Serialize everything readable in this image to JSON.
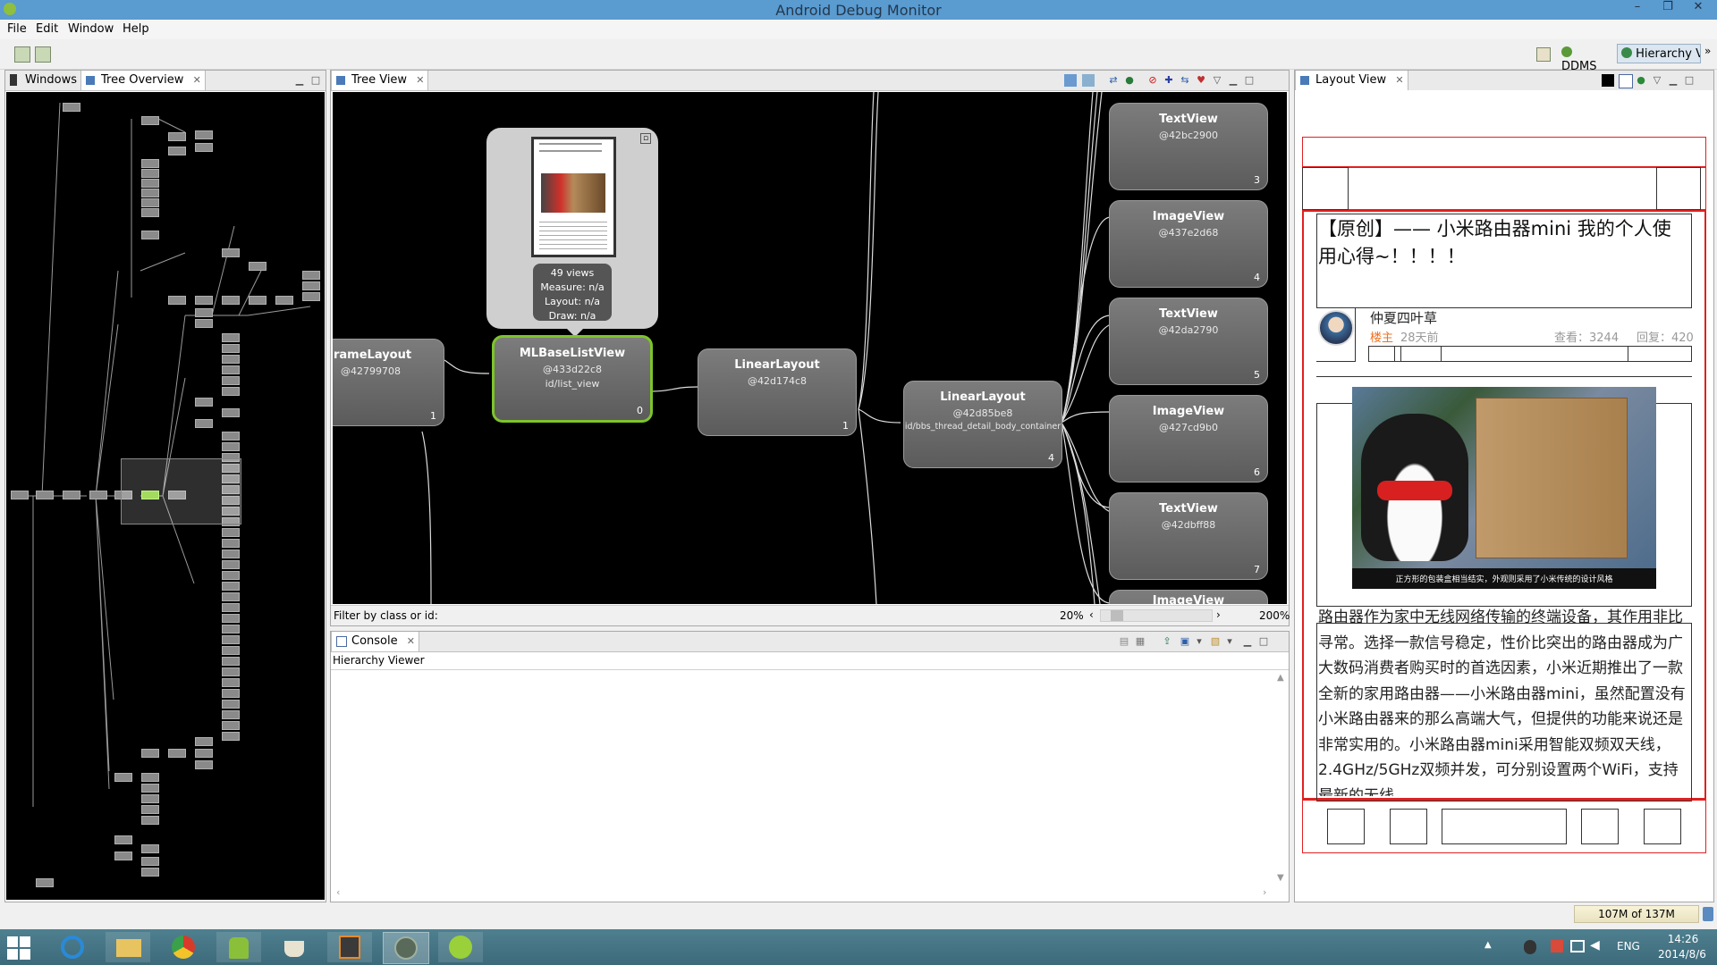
{
  "window": {
    "title": "Android Debug Monitor",
    "controls": [
      "–",
      "❐",
      "✕"
    ]
  },
  "menu": [
    "File",
    "Edit",
    "Window",
    "Help"
  ],
  "perspectives": {
    "ddms": "DDMS",
    "hierarchy": "Hierarchy Vi"
  },
  "left_panel": {
    "tabs": [
      "Windows",
      "Tree Overview"
    ]
  },
  "tree_view": {
    "tab": "Tree View",
    "preview": {
      "views": "49 views",
      "measure": "Measure: n/a",
      "layout": "Layout: n/a",
      "draw": "Draw: n/a"
    },
    "nodes": [
      {
        "cls": "rameLayout",
        "hash": "@42799708",
        "id": "",
        "index": "1"
      },
      {
        "cls": "MLBaseListView",
        "hash": "@433d22c8",
        "id": "id/list_view",
        "index": "0"
      },
      {
        "cls": "LinearLayout",
        "hash": "@42d174c8",
        "id": "",
        "index": "1"
      },
      {
        "cls": "LinearLayout",
        "hash": "@42d85be8",
        "id": "id/bbs_thread_detail_body_container",
        "index": "4"
      },
      {
        "cls": "TextView",
        "hash": "@42bc2900",
        "id": "",
        "index": "3"
      },
      {
        "cls": "ImageView",
        "hash": "@437e2d68",
        "id": "",
        "index": "4"
      },
      {
        "cls": "TextView",
        "hash": "@42da2790",
        "id": "",
        "index": "5"
      },
      {
        "cls": "ImageView",
        "hash": "@427cd9b0",
        "id": "",
        "index": "6"
      },
      {
        "cls": "TextView",
        "hash": "@42dbff88",
        "id": "",
        "index": "7"
      },
      {
        "cls": "ImageView",
        "hash": "",
        "id": "",
        "index": ""
      }
    ],
    "filter_label": "Filter by class or id:",
    "zoom_min": "20%",
    "zoom_max": "200%",
    "zoom_level": 0.1
  },
  "console": {
    "tab": "Console",
    "header": "Hierarchy Viewer"
  },
  "layout_view": {
    "tab": "Layout View",
    "post_title": "【原创】—— 小米路由器mini 我的个人使用心得~！！！！",
    "author": "仲夏四叶草",
    "badge": "楼主",
    "time": "28天前",
    "views": "查看：3244",
    "replies": "回复：420",
    "image_caption": "正方形的包装盒相当结实，外观则采用了小米传统的设计风格",
    "body": "路由器作为家中无线网络传输的终端设备，其作用非比寻常。选择一款信号稳定，性价比突出的路由器成为广大数码消费者购买时的首选因素，小米近期推出了一款全新的家用路由器——小米路由器mini，虽然配置没有小米路由器来的那么高端大气，但提供的功能来说还是非常实用的。小米路由器mini采用智能双频双天线，2.4GHz/5GHz双频并发，可分别设置两个WiFi，支持最新的无线"
  },
  "status": {
    "memory": "107M of 137M"
  },
  "taskbar": {
    "lang": "ENG",
    "time": "14:26",
    "date": "2014/8/6"
  },
  "colors": {
    "selected_node_border": "#7dc42a",
    "layout_outline": "#e02020"
  }
}
